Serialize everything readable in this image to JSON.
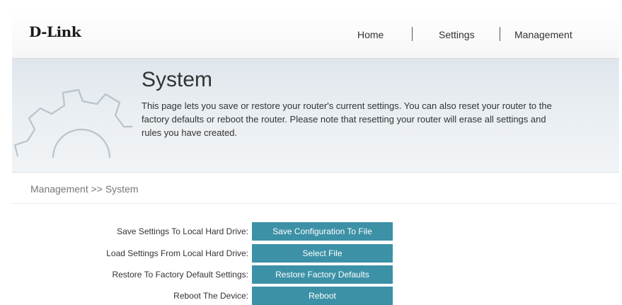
{
  "header": {
    "logo": "D-Link",
    "nav": [
      {
        "label": "Home"
      },
      {
        "label": "Settings"
      },
      {
        "label": "Management"
      }
    ]
  },
  "banner": {
    "title": "System",
    "description": "This page lets you save or restore your router's current settings. You can also reset your router to the factory defaults or reboot the router. Please note that resetting your router will erase all settings and rules you have created.",
    "icon": "gear-icon"
  },
  "breadcrumb": "Management >> System",
  "actions": [
    {
      "label": "Save Settings To Local Hard Drive:",
      "button": "Save Configuration To File"
    },
    {
      "label": "Load Settings From Local Hard Drive:",
      "button": "Select File"
    },
    {
      "label": "Restore To Factory Default Settings:",
      "button": "Restore Factory Defaults"
    },
    {
      "label": "Reboot The Device:",
      "button": "Reboot"
    }
  ],
  "colors": {
    "button": "#3c91a6",
    "banner": "#e4eaef"
  }
}
